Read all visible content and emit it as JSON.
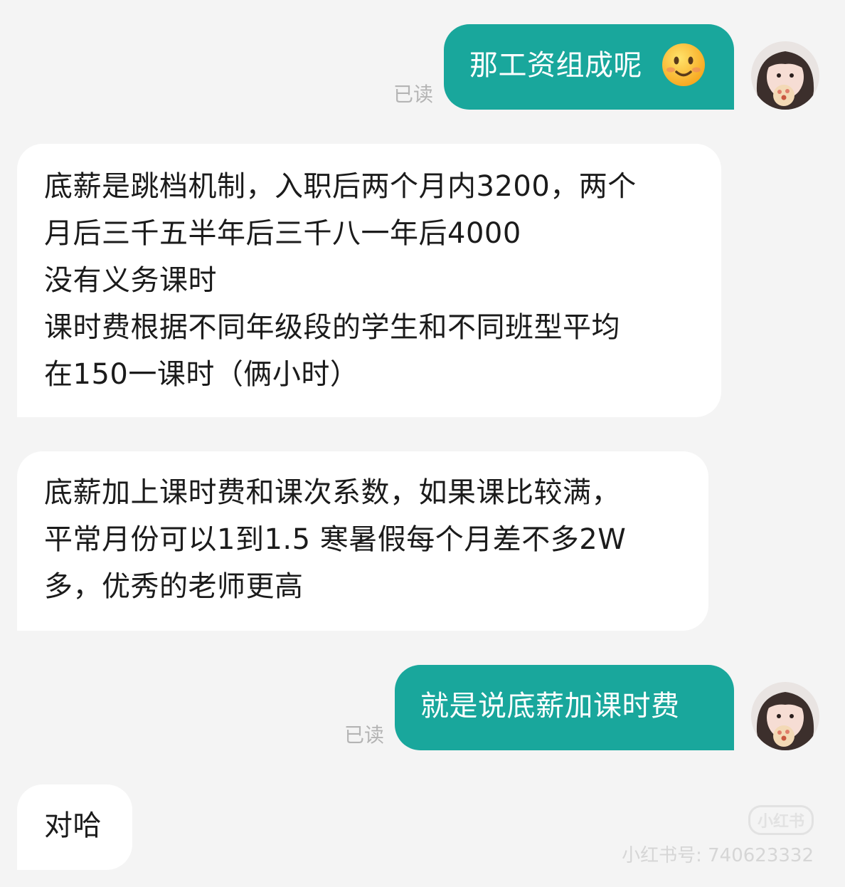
{
  "messages": [
    {
      "side": "out",
      "text": "那工资组成呢",
      "emoji": "slightly-smiling-face",
      "status": "已读"
    },
    {
      "side": "in",
      "lines": [
        "底薪是跳档机制，入职后两个月内3200，两个",
        "月后三千五半年后三千八一年后4000",
        "没有义务课时",
        "课时费根据不同年级段的学生和不同班型平均",
        "在150一课时（俩小时）"
      ]
    },
    {
      "side": "in",
      "lines": [
        "底薪加上课时费和课次系数，如果课比较满，",
        "平常月份可以1到1.5 寒暑假每个月差不多2W",
        "多，优秀的老师更高"
      ]
    },
    {
      "side": "out",
      "text": "就是说底薪加课时费",
      "status": "已读"
    },
    {
      "side": "in",
      "lines": [
        "对哈"
      ]
    }
  ],
  "watermark": {
    "logo": "小红书",
    "id_text": "小红书号: 740623332"
  },
  "colors": {
    "outgoing_bubble": "#19a79c",
    "incoming_bubble": "#ffffff",
    "background": "#f4f4f4",
    "read_status": "#b4b4b4"
  }
}
